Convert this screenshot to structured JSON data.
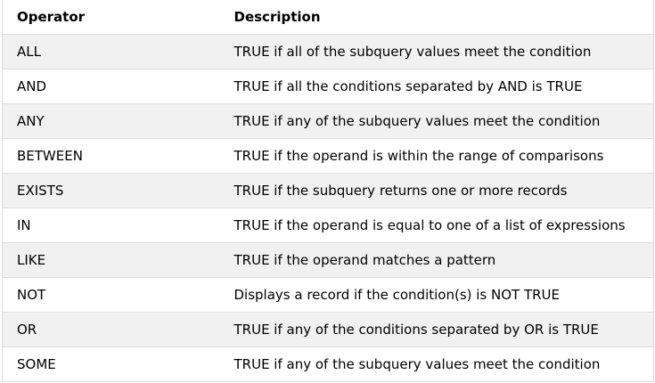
{
  "table": {
    "headers": [
      "Operator",
      "Description"
    ],
    "rows": [
      [
        "ALL",
        "TRUE if all of the subquery values meet the condition"
      ],
      [
        "AND",
        "TRUE if all the conditions separated by AND is TRUE"
      ],
      [
        "ANY",
        "TRUE if any of the subquery values meet the condition"
      ],
      [
        "BETWEEN",
        "TRUE if the operand is within the range of comparisons"
      ],
      [
        "EXISTS",
        "TRUE if the subquery returns one or more records"
      ],
      [
        "IN",
        "TRUE if the operand is equal to one of a list of expressions"
      ],
      [
        "LIKE",
        "TRUE if the operand matches a pattern"
      ],
      [
        "NOT",
        "Displays a record if the condition(s) is NOT TRUE"
      ],
      [
        "OR",
        "TRUE if any of the conditions separated by OR is TRUE"
      ],
      [
        "SOME",
        "TRUE if any of the subquery values meet the condition"
      ]
    ]
  },
  "colors": {
    "stripe": "#f1f1f1",
    "border": "#dddddd",
    "text": "#000000"
  }
}
